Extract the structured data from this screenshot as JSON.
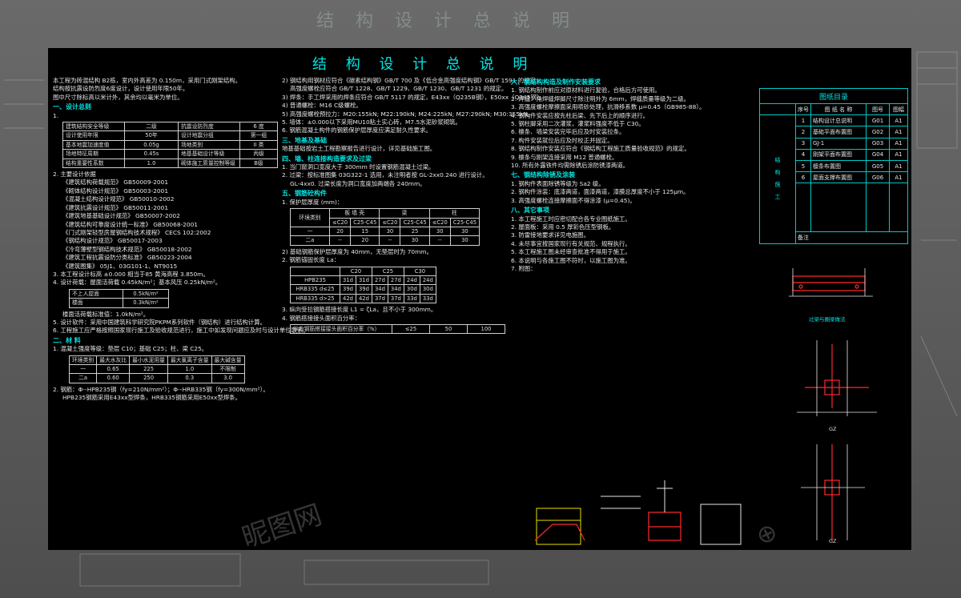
{
  "page_title": "结 构 设 计 总 说 明",
  "col1": {
    "intro": [
      "本工程为砖混结构 B2栋，室内外高差为 0.150m，采用门式刚架结构。",
      "结构按抗震设防烈度6度设计，设计使用年限50年。",
      "图中尺寸除标高以米计外，其余均以毫米为单位。"
    ],
    "sec1": "一、设计总则",
    "item1": "1.",
    "params": [
      [
        "建筑结构安全等级",
        "二级",
        "抗震设防烈度",
        "6 度"
      ],
      [
        "设计使用年限",
        "50年",
        "设计地震分组",
        "第一组"
      ],
      [
        "基本地震加速度值",
        "0.05g",
        "场地类别",
        "II 类"
      ],
      [
        "场地特征周期",
        "0.45s",
        "地基基础设计等级",
        "丙级"
      ],
      [
        "结构重要性系数",
        "1.0",
        "砌体施工质量控制等级",
        "B级"
      ]
    ],
    "item2": "2. 主要设计依据",
    "codes": [
      "《建筑结构荷载规范》 GB50009-2001",
      "《砌体结构设计规范》 GB50003-2001",
      "《混凝土结构设计规范》 GB50010-2002",
      "《建筑抗震设计规范》 GB50011-2001",
      "《建筑地基基础设计规范》 GB50007-2002",
      "《建筑结构可靠度设计统一标准》 GB50068-2001",
      "《门式刚架轻型房屋钢结构技术规程》 CECS 102:2002",
      "《钢结构设计规范》 GB50017-2003",
      "《冷弯薄壁型钢结构技术规范》 GB50018-2002",
      "《建筑工程抗震设防分类标准》 GB50223-2004",
      "《建筑图集》 05J1、03G101-1、NT9015"
    ],
    "item3": "3. 本工程设计标高 ±0.000 相当于85 黄海高程 3.850m。",
    "item4": "4. 设计荷载：屋面活荷载 0.45kN/m²；基本风压 0.25kN/m²。",
    "loads": [
      [
        "不上人屋面",
        "0.5kN/m²"
      ],
      [
        "楼面",
        "0.3kN/m²"
      ]
    ],
    "item4b": "楼面活荷载标准值：1.0kN/m²。",
    "item5": "5. 设计软件：采用中国建筑科学研究院PKPM系列软件（钢结构）进行结构计算。",
    "item6": "6. 工程施工应严格按照国家现行施工及验收规范进行，施工中如发现问题应及时与设计单位联系。",
    "sec2": "二、材 料",
    "mat1": "1. 混凝土强度等级：垫层 C10；基础 C25；柱、梁 C25。",
    "mat_table": [
      [
        "环境类别",
        "最大水灰比",
        "最小水泥用量",
        "最大氯离子含量",
        "最大碱含量"
      ],
      [
        "一",
        "0.65",
        "225",
        "1.0",
        "不限制"
      ],
      [
        "二a",
        "0.60",
        "250",
        "0.3",
        "3.0"
      ]
    ],
    "mat2": "2. 钢筋：Φ--HPB235钢（fy=210N/mm²）；Φ--HRB335钢（fy=300N/mm²）。",
    "mat2b": "HPB235钢筋采用E43xx型焊条，HRB335钢筋采用E50xx型焊条。"
  },
  "col2": {
    "c1": "2) 钢结构用钢材应符合《碳素结构钢》GB/T 700 及《低合金高强度结构钢》GB/T 1591 的规定；",
    "c2": "高强度螺栓应符合 GB/T 1228、GB/T 1229、GB/T 1230、GB/T 1231 的规定。",
    "c3": "3) 焊条：手工焊采用的焊条应符合 GB/T 5117 的规定，E43xx（Q235B钢），E50xx（Q345钢）。",
    "c4": "4) 普通螺栓：M16  C级螺栓。",
    "c5": "5) 高强度螺栓预拉力：M20:155kN; M22:190kN; M24:225kN; M27:290kN; M30:355kN。",
    "c6": "5. 墙体：±0.000以下采用MU10粘土实心砖，M7.5水泥砂浆砌筑。",
    "c7": "6. 钢筋混凝土构件的钢筋保护层厚度应满足耐久性要求。",
    "sec3": "三、地基及基础",
    "f1": "地基基础按岩土工程勘察报告进行设计，详见基础施工图。",
    "sec4": "四、墙、柱连接构造要求及过梁",
    "w1": "1. 当门窗洞口宽度大于 300mm 时设置钢筋混凝土过梁。",
    "w2": "2. 过梁：按标准图集 03G322-1 选用，未注明者按 GL-2xx0.240 进行设计。",
    "w3": "GL-4xx0. 过梁长度为洞口宽度加两端各 240mm。",
    "sec5": "五、钢筋砼构件",
    "r1": "1. 保护层厚度 (mm)：",
    "cover": [
      [
        "环境类别",
        "板 墙 壳",
        "",
        "梁",
        "",
        "柱",
        ""
      ],
      [
        "",
        "≤C20",
        "C25-C45",
        "≤C20",
        "C25-C45",
        "≤C20",
        "C25-C45"
      ],
      [
        "一",
        "20",
        "15",
        "30",
        "25",
        "30",
        "30"
      ],
      [
        "二a",
        "--",
        "20",
        "--",
        "30",
        "--",
        "30"
      ]
    ],
    "r2": "2) 基础钢筋保护层厚度为 40mm，无垫层时为 70mm。",
    "r3": "2. 钢筋锚固长度 La：",
    "anchor": [
      [
        "",
        "C20",
        "",
        "C25",
        "",
        "C30",
        ""
      ],
      [
        "HPB235",
        "31d",
        "31d",
        "27d",
        "27d",
        "24d",
        "24d"
      ],
      [
        "HRB335 d≤25",
        "39d",
        "39d",
        "34d",
        "34d",
        "30d",
        "30d"
      ],
      [
        "HRB335 d>25",
        "42d",
        "42d",
        "37d",
        "37d",
        "33d",
        "33d"
      ]
    ],
    "r4": "3. 纵向受拉钢筋搭接长度 L1 = ζLa，且不小于 300mm。",
    "r5": "4. 钢筋搭接接头面积百分率：",
    "lap": [
      [
        "纵向钢筋搭接接头面积百分率（%）",
        "≤25",
        "50",
        "100"
      ]
    ]
  },
  "col3": {
    "sec6": "六、钢结构构造及制作安装要求",
    "s1": "1. 钢结构制作前应对原材料进行复验，合格后方可使用。",
    "s2": "2. 焊缝：角焊缝焊脚尺寸除注明外为 6mm，焊缝质量等级为二级。",
    "s3": "3. 高强度螺栓摩擦面采用喷砂处理，抗滑移系数 μ=0.45（GB985-88）。",
    "s4": "4. 钢构件安装应按先柱后梁、先下后上的顺序进行。",
    "s5": "5. 钢柱脚采用二次灌浆，灌浆料强度不低于 C30。",
    "s6": "6. 檩条、墙梁安装完毕后应及时安装拉条。",
    "s7": "7. 构件安装就位后应及时校正并固定。",
    "s8": "8. 钢结构制作安装应符合《钢结构工程施工质量验收规范》的规定。",
    "s9": "9. 檩条与刚架连接采用 M12 普通螺栓。",
    "s10": "10. 所有外露铁件均需除锈后涂防锈漆两道。",
    "sec7": "七、钢结构除锈及涂装",
    "t1": "1. 钢构件表面除锈等级为 Sa2 级。",
    "t2": "2. 钢构件涂装：底漆两道，面漆两道，漆膜总厚度不小于 125μm。",
    "t3": "3. 高强度螺栓连接摩擦面不得涂漆 (μ=0.45)。",
    "sec8": "八、其它事项",
    "o1": "1. 本工程施工时应密切配合各专业图纸施工。",
    "o2": "2. 屋面板：采用 0.5 厚彩色压型钢板。",
    "o3": "3. 防雷接地要求详见电施图。",
    "o4": "4. 未尽事宜按国家现行有关规范、规程执行。",
    "o5": "5. 本工程施工图未经审查批准不得用于施工。",
    "o6": "6. 本说明与各施工图不符时，以施工图为准。",
    "o7": "7. 附图："
  },
  "index": {
    "title": "图纸目录",
    "headers": [
      "序号",
      "图 纸 名 称",
      "图号",
      "图幅"
    ],
    "side_label": "结 构 施 工",
    "rows": [
      [
        "1",
        "结构设计总说明",
        "G01",
        "A1"
      ],
      [
        "2",
        "基础平面布置图",
        "G02",
        "A1"
      ],
      [
        "3",
        "GJ-1",
        "G03",
        "A1"
      ],
      [
        "4",
        "刚架平面布置图",
        "G04",
        "A1"
      ],
      [
        "5",
        "檩条布置图",
        "G05",
        "A1"
      ],
      [
        "6",
        "屋面支撑布置图",
        "G06",
        "A1"
      ]
    ],
    "footer": "备注"
  },
  "drawings": {
    "beam_caption": "过梁与圈梁做法",
    "col_caption_1": "GZ",
    "col_caption_2": "GZ"
  },
  "watermark": "昵图网",
  "colors": {
    "accent": "#00e5e5",
    "red": "#ff2a2a",
    "yellow": "#e8e000"
  }
}
